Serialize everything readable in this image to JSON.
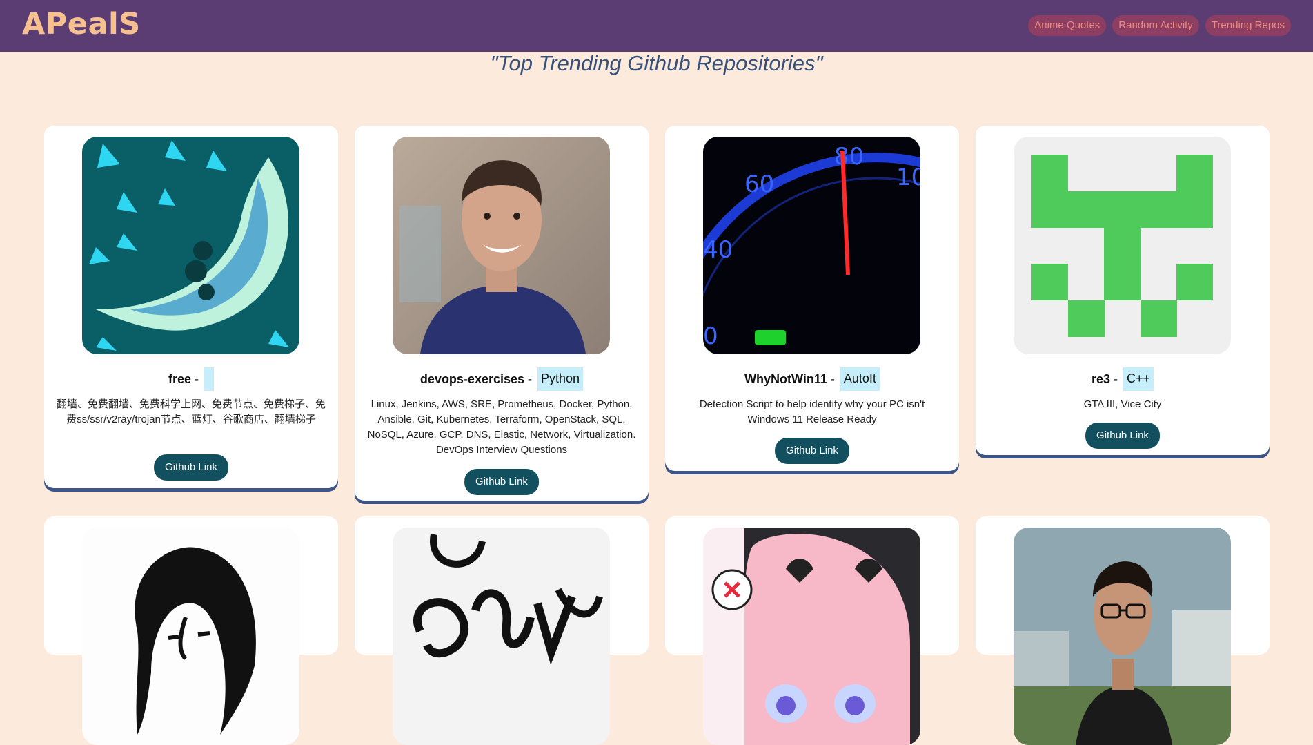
{
  "brand": "APealS",
  "nav": [
    "Anime Quotes",
    "Random Activity",
    "Trending Repos"
  ],
  "page_title": "\"Top Trending Github Repositories\"",
  "button_label": "Github Link",
  "repos": [
    {
      "name": "free -",
      "language": "",
      "description": "翻墙、免费翻墙、免费科学上网、免费节点、免费梯子、免费ss/ssr/v2ray/trojan节点、蓝灯、谷歌商店、翻墙梯子",
      "avatar": "crescent-blade-avatar"
    },
    {
      "name": "devops-exercises -",
      "language": "Python",
      "description": "Linux, Jenkins, AWS, SRE, Prometheus, Docker, Python, Ansible, Git, Kubernetes, Terraform, OpenStack, SQL, NoSQL, Azure, GCP, DNS, Elastic, Network, Virtualization. DevOps Interview Questions",
      "avatar": "smiling-man-photo"
    },
    {
      "name": "WhyNotWin11 -",
      "language": "AutoIt",
      "description": "Detection Script to help identify why your PC isn't Windows 11 Release Ready",
      "avatar": "speedometer-photo"
    },
    {
      "name": "re3 -",
      "language": "C++",
      "description": "GTA III, Vice City",
      "avatar": "green-pixel-identicon"
    }
  ],
  "second_row_avatars": [
    "sketch-face-drawing",
    "calligraphy-logo",
    "anime-girl-avatar",
    "man-with-glasses-photo"
  ]
}
